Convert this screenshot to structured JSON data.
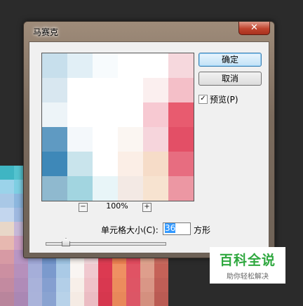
{
  "dialog": {
    "title": "马赛克",
    "close_label": "✕"
  },
  "buttons": {
    "ok_label": "确定",
    "cancel_label": "取消"
  },
  "preview_checkbox": {
    "label": "预览(P)",
    "checked": true,
    "check_mark": "✓"
  },
  "zoom": {
    "minus_label": "−",
    "plus_label": "+",
    "value": "100%"
  },
  "cell_size": {
    "label": "单元格大小(C):",
    "value": "36",
    "unit": "方形"
  },
  "slider": {
    "value": 36
  },
  "preview_mosaic_colors": [
    [
      "#c7dfec",
      "#e1eff6",
      "#f7fbfd",
      "#ffffff",
      "#ffffff",
      "#f6d8dd"
    ],
    [
      "#d8e7f0",
      "#ffffff",
      "#ffffff",
      "#ffffff",
      "#fbefef",
      "#f4bfc8"
    ],
    [
      "#edf4f8",
      "#ffffff",
      "#ffffff",
      "#ffffff",
      "#f7c9d2",
      "#e85b6f"
    ],
    [
      "#5f9ac2",
      "#f4f8fb",
      "#ffffff",
      "#fbf6f2",
      "#f6d5dc",
      "#e34f66"
    ],
    [
      "#3e88b8",
      "#c9e4ec",
      "#ffffff",
      "#fbeee6",
      "#f6dcc8",
      "#e76d80"
    ],
    [
      "#8fb9cf",
      "#a2d5e0",
      "#e8f5f8",
      "#f3e9e4",
      "#f7e3d0",
      "#ec97a3"
    ]
  ],
  "background_mosaic_colors": [
    [
      "#3fb5c3",
      "#54c3cf",
      "#8ed6dc",
      "#2a2a2a",
      "#2a2a2a",
      "#2a2a2a",
      "#2a2a2a",
      "#2a2a2a",
      "#2a2a2a",
      "#2a2a2a",
      "#2a2a2a",
      "#2a2a2a"
    ],
    [
      "#9bd3ea",
      "#7ecfe3",
      "#b9e3ef",
      "#2a2a2a",
      "#2a2a2a",
      "#2a2a2a",
      "#2a2a2a",
      "#2a2a2a",
      "#2a2a2a",
      "#2a2a2a",
      "#2a2a2a",
      "#2a2a2a"
    ],
    [
      "#a9c8e6",
      "#8cb7de",
      "#c7dcef",
      "#2a2a2a",
      "#2a2a2a",
      "#2a2a2a",
      "#2a2a2a",
      "#2a2a2a",
      "#2a2a2a",
      "#2a2a2a",
      "#2a2a2a",
      "#2a2a2a"
    ],
    [
      "#c3d6ee",
      "#9fb9e0",
      "#d4e2f2",
      "#2a2a2a",
      "#2a2a2a",
      "#2a2a2a",
      "#2a2a2a",
      "#2a2a2a",
      "#2a2a2a",
      "#2a2a2a",
      "#2a2a2a",
      "#2a2a2a"
    ],
    [
      "#e8d7c8",
      "#c6b8d8",
      "#b5c9e8",
      "#2a2a2a",
      "#2a2a2a",
      "#2a2a2a",
      "#2a2a2a",
      "#2a2a2a",
      "#2a2a2a",
      "#2a2a2a",
      "#2a2a2a",
      "#2a2a2a"
    ],
    [
      "#e7b8b0",
      "#cfa1c4",
      "#8d9fd0",
      "#5e86c6",
      "#7ab0d9",
      "#eef3f7",
      "#f6e6ea",
      "#e94a62",
      "#e06548",
      "#e44c5f",
      "#e8b9a7",
      "#d27e6b"
    ],
    [
      "#d79aa4",
      "#b896c4",
      "#9fa7d6",
      "#6f92c8",
      "#9ec3e2",
      "#f7f2ee",
      "#f2d5da",
      "#dd3c53",
      "#ea7f51",
      "#e24b5e",
      "#e0a48e",
      "#c86a5e"
    ],
    [
      "#cc8fa1",
      "#b690bc",
      "#a5aed9",
      "#7b9acd",
      "#aacae6",
      "#f9f5f2",
      "#f0c8cf",
      "#dc3a51",
      "#ef9062",
      "#e05364",
      "#de9e8c",
      "#c56258"
    ],
    [
      "#c38aa0",
      "#b08bb8",
      "#a9b2da",
      "#859fd0",
      "#b3cfe8",
      "#f7efe9",
      "#efc1c8",
      "#d93850",
      "#ec8c5d",
      "#de5565",
      "#d99686",
      "#bf5e56"
    ],
    [
      "#b9859c",
      "#aa87b4",
      "#aab3da",
      "#8aa3d1",
      "#b8d2e9",
      "#f5ebe4",
      "#ebbcc3",
      "#d6374e",
      "#e8885a",
      "#dc5666",
      "#d4907f",
      "#ba5b53"
    ]
  ],
  "watermark": {
    "main": "百科全说",
    "sub": "助你轻松解决"
  }
}
